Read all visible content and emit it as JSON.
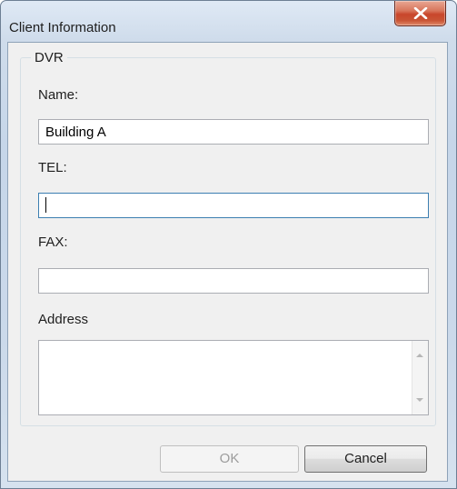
{
  "window": {
    "title": "Client Information"
  },
  "group": {
    "title": "DVR"
  },
  "fields": {
    "name_label": "Name:",
    "name_value": "Building A",
    "tel_label": "TEL:",
    "tel_value": "",
    "fax_label": "FAX:",
    "fax_value": "",
    "address_label": "Address",
    "address_value": ""
  },
  "buttons": {
    "ok_label": "OK",
    "cancel_label": "Cancel"
  },
  "icons": {
    "close": "close-icon",
    "scroll_up": "scroll-up-arrow-icon",
    "scroll_down": "scroll-down-arrow-icon"
  },
  "state": {
    "focused_field": "TEL",
    "ok_enabled": false
  }
}
